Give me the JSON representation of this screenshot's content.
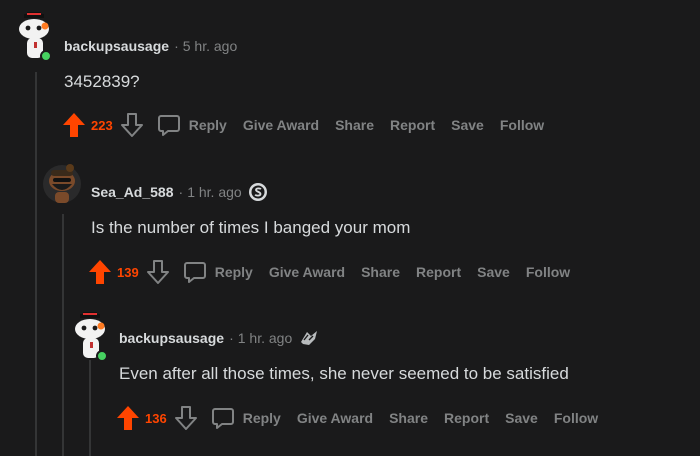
{
  "comments": [
    {
      "username": "backupsausage",
      "separator": "·",
      "time": "5 hr. ago",
      "body": "3452839?",
      "score": "223",
      "actions": {
        "reply": "Reply",
        "give_award": "Give Award",
        "share": "Share",
        "report": "Report",
        "save": "Save",
        "follow": "Follow"
      }
    },
    {
      "username": "Sea_Ad_588",
      "separator": "·",
      "time": "1 hr. ago",
      "body": "Is the number of times I banged your mom",
      "score": "139",
      "actions": {
        "reply": "Reply",
        "give_award": "Give Award",
        "share": "Share",
        "report": "Report",
        "save": "Save",
        "follow": "Follow"
      }
    },
    {
      "username": "backupsausage",
      "separator": "·",
      "time": "1 hr. ago",
      "body": "Even after all those times, she never seemed to be satisfied",
      "score": "136",
      "actions": {
        "reply": "Reply",
        "give_award": "Give Award",
        "share": "Share",
        "report": "Report",
        "save": "Save",
        "follow": "Follow"
      }
    }
  ],
  "colors": {
    "background": "#1a1a1b",
    "upvote": "#ff4500",
    "muted": "#818384",
    "text": "#d7dadc",
    "online": "#46d160"
  },
  "icons": [
    "snoo-avatar-icon",
    "online-status-icon",
    "upvote-arrow-icon",
    "downvote-arrow-icon",
    "comment-bubble-icon",
    "snoo-coin-flair-icon",
    "award-flair-icon"
  ]
}
